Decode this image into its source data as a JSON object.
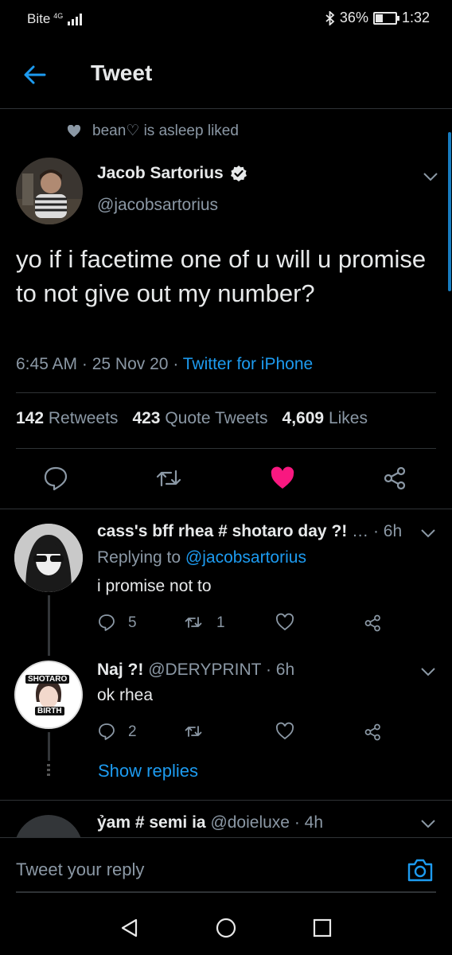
{
  "status": {
    "carrier": "Bite",
    "network": "4G",
    "network_sub": "4G",
    "battery": "36%",
    "battery_level": 0.36,
    "time": "1:32"
  },
  "header": {
    "title": "Tweet"
  },
  "tweet": {
    "social_context": "bean♡ is asleep liked",
    "author_name": "Jacob Sartorius",
    "author_handle": "@jacobsartorius",
    "text": "yo if i facetime one of u will u promise to not give out my number?",
    "time": "6:45 AM",
    "date": "25 Nov 20",
    "source": "Twitter for iPhone",
    "retweets_count": "142",
    "retweets_label": "Retweets",
    "quotes_count": "423",
    "quotes_label": "Quote Tweets",
    "likes_count": "4,609",
    "likes_label": "Likes"
  },
  "replies": [
    {
      "display_name": "cass's bff rhea # shotaro day ?!",
      "ellipsis": "…",
      "handle": "",
      "age": "· 6h",
      "replying_prefix": "Replying to",
      "replying_to": "@jacobsartorius",
      "text": "i promise not to",
      "reply_count": "5",
      "retweet_count": "1"
    },
    {
      "display_name": "Naj ?!",
      "handle": "@DERYPRINT",
      "age": "· 6h",
      "text": "ok rhea",
      "reply_count": "2",
      "avatar_top": "SHOTARO",
      "avatar_bottom": "BIRTH"
    },
    {
      "display_name": "ỷam # semi ia",
      "handle": "@doieluxe",
      "age": "· 4h"
    }
  ],
  "show_replies": "Show replies",
  "reply_placeholder": "Tweet your reply",
  "colors": {
    "accent": "#1d9bf0",
    "like": "#f91880",
    "background": "#000000"
  }
}
